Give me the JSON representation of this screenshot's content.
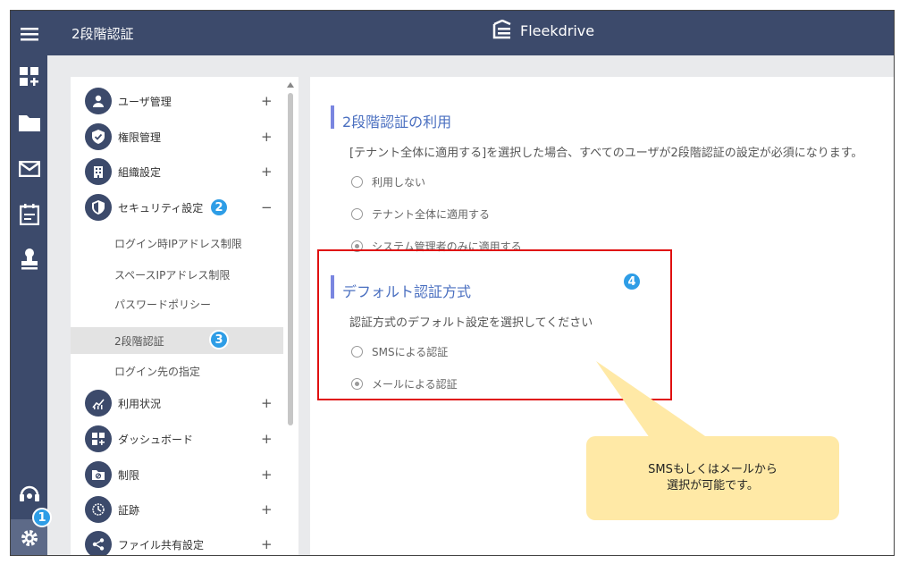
{
  "header": {
    "title": "2段階認証",
    "brand": "Fleekdrive"
  },
  "rail": {
    "icons": [
      "menu-icon",
      "dashboard-add-icon",
      "folder-icon",
      "mail-icon",
      "calendar-icon",
      "stamp-icon",
      "support-icon",
      "gear-icon"
    ],
    "badge": "1"
  },
  "sidebar": {
    "items": [
      {
        "label": "ユーザ管理",
        "sign": "+",
        "icon": "user-icon"
      },
      {
        "label": "権限管理",
        "sign": "+",
        "icon": "shield-check-icon"
      },
      {
        "label": "組織設定",
        "sign": "+",
        "icon": "building-icon"
      },
      {
        "label": "セキュリティ設定",
        "sign": "−",
        "icon": "security-shield-icon",
        "badge": "2"
      },
      {
        "label": "利用状況",
        "sign": "+",
        "icon": "chart-icon"
      },
      {
        "label": "ダッシュボード",
        "sign": "+",
        "icon": "dashboard-icon"
      },
      {
        "label": "制限",
        "sign": "+",
        "icon": "folder-restrict-icon"
      },
      {
        "label": "証跡",
        "sign": "+",
        "icon": "history-icon"
      },
      {
        "label": "ファイル共有設定",
        "sign": "+",
        "icon": "share-icon"
      }
    ],
    "subitems": [
      {
        "label": "ログイン時IPアドレス制限"
      },
      {
        "label": "スペースIPアドレス制限"
      },
      {
        "label": "パスワードポリシー"
      },
      {
        "label": "2段階認証",
        "badge": "3"
      },
      {
        "label": "ログイン先の指定"
      }
    ]
  },
  "main": {
    "section1": {
      "title": "2段階認証の利用",
      "description": "[テナント全体に適用する]を選択した場合、すべてのユーザが2段階認証の設定が必須になります。",
      "options": [
        {
          "label": "利用しない",
          "checked": false
        },
        {
          "label": "テナント全体に適用する",
          "checked": false
        },
        {
          "label": "システム管理者のみに適用する",
          "checked": true
        }
      ]
    },
    "section2": {
      "title": "デフォルト認証方式",
      "badge": "4",
      "description": "認証方式のデフォルト設定を選択してください",
      "options": [
        {
          "label": "SMSによる認証",
          "checked": false
        },
        {
          "label": "メールによる認証",
          "checked": true
        }
      ]
    }
  },
  "callout": {
    "line1": "SMSもしくはメールから",
    "line2": "選択が可能です。"
  },
  "colors": {
    "nav": "#3c4a6b",
    "accent_bar": "#7a86e0",
    "section_title": "#4a6fc0",
    "badge": "#2e9de6",
    "highlight": "#e01010",
    "callout": "#ffe9a6"
  }
}
